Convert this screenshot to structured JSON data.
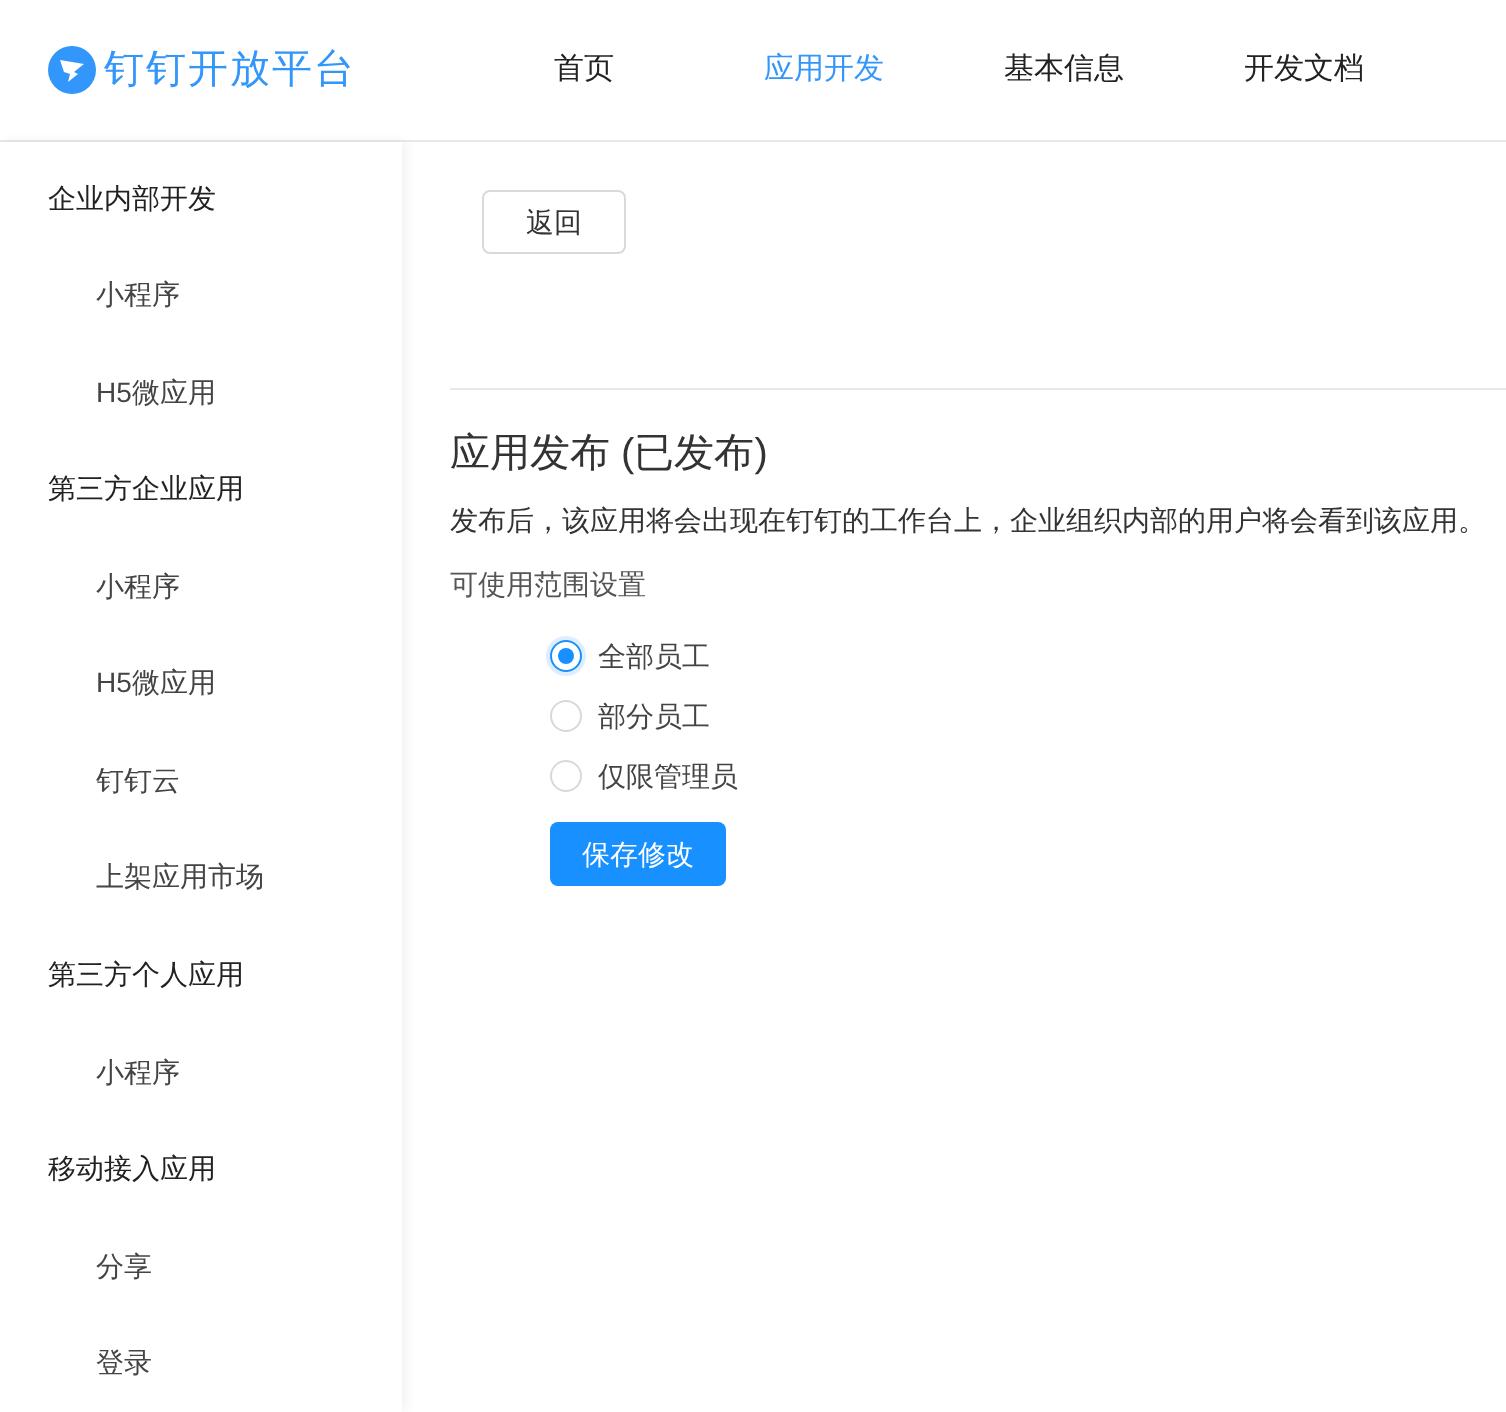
{
  "header": {
    "logo": "钉钉开放平台",
    "nav": [
      {
        "label": "首页",
        "selected": false
      },
      {
        "label": "应用开发",
        "selected": true
      },
      {
        "label": "基本信息",
        "selected": false
      },
      {
        "label": "开发文档",
        "selected": false
      }
    ]
  },
  "sidebar": {
    "items": [
      {
        "label": "企业内部开发",
        "children": [
          {
            "label": "小程序"
          },
          {
            "label": "H5微应用"
          }
        ]
      },
      {
        "label": "第三方企业应用",
        "children": [
          {
            "label": "小程序"
          },
          {
            "label": "H5微应用"
          },
          {
            "label": "钉钉云"
          },
          {
            "label": "上架应用市场"
          }
        ]
      },
      {
        "label": "第三方个人应用",
        "children": [
          {
            "label": "小程序"
          }
        ]
      },
      {
        "label": "移动接入应用",
        "children": [
          {
            "label": "分享"
          },
          {
            "label": "登录"
          }
        ]
      }
    ]
  },
  "back_button": "返回",
  "section": {
    "title": "应用发布 (已发布)",
    "description": "发布后，该应用将会出现在钉钉的工作台上，企业组织内部的用户将会看到该应用。",
    "scope_label": "可使用范围设置",
    "options": [
      {
        "label": "全部员工",
        "selected": true
      },
      {
        "label": "部分员工",
        "selected": false
      },
      {
        "label": "仅限管理员",
        "selected": false
      }
    ],
    "save_button": "保存修改"
  }
}
